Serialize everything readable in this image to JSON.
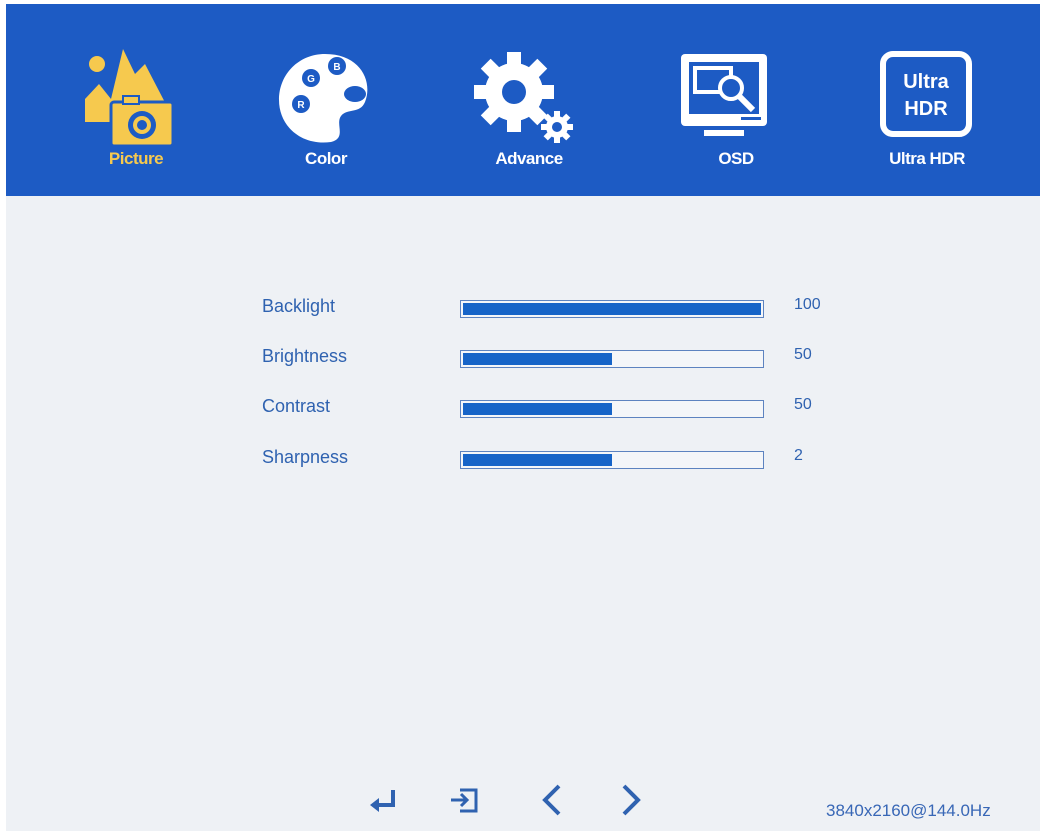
{
  "menu": {
    "tabs": [
      {
        "label": "Picture",
        "icon": "picture-icon",
        "active": true
      },
      {
        "label": "Color",
        "icon": "color-palette-icon",
        "active": false
      },
      {
        "label": "Advance",
        "icon": "gear-icon",
        "active": false
      },
      {
        "label": "OSD",
        "icon": "osd-monitor-icon",
        "active": false
      },
      {
        "label": "Ultra HDR",
        "icon": "ultra-hdr-icon",
        "active": false,
        "icon_text": [
          "Ultra",
          "HDR"
        ]
      }
    ]
  },
  "picture": {
    "settings": [
      {
        "label": "Backlight",
        "value": "100",
        "level_percent": 100
      },
      {
        "label": "Brightness",
        "value": "50",
        "level_percent": 50
      },
      {
        "label": "Contrast",
        "value": "50",
        "level_percent": 50
      },
      {
        "label": "Sharpness",
        "value": "2",
        "level_percent": 50
      }
    ]
  },
  "footer": {
    "hints": [
      "enter-icon",
      "exit-icon",
      "left-arrow-icon",
      "right-arrow-icon"
    ],
    "resolution": "3840x2160@144.0Hz"
  },
  "colors": {
    "header_bg": "#1d5bc4",
    "active_tab": "#f6c94e",
    "bar_fill": "#1664c8",
    "text": "#2f62b0",
    "panel_bg": "#eef1f5"
  }
}
